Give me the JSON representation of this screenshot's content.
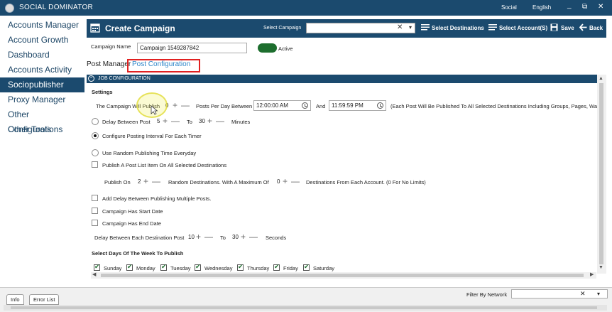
{
  "titlebar": {
    "app_title": "SOCIAL DOMINATOR",
    "menu_social": "Social",
    "menu_language": "English",
    "minimize": "_",
    "restore": "⧉",
    "close": "✕"
  },
  "sidebar": {
    "items": [
      {
        "label": "Accounts Manager"
      },
      {
        "label": "Account Growth"
      },
      {
        "label": "Dashboard"
      },
      {
        "label": "Accounts Activity"
      },
      {
        "label": "Sociopublisher"
      },
      {
        "label": "Proxy Manager"
      },
      {
        "label": "Other Configurations"
      },
      {
        "label": "Other Tools"
      }
    ],
    "active_index": 4
  },
  "header": {
    "title": "Create Campaign",
    "select_campaign_label": "Select Campaign",
    "select_campaign_value": "",
    "clear_glyph": "✕",
    "dropdown_glyph": "▾",
    "select_destinations": "Select Destinations",
    "select_accounts": "Select Account(S)",
    "save": "Save",
    "back": "Back"
  },
  "campaign": {
    "name_label": "Campaign Name",
    "name_value": "Campaign 1549287842",
    "active_label": "Active",
    "active": true
  },
  "tabs": {
    "post_manager": "Post Manager",
    "post_configuration": "Post Configuration"
  },
  "section": {
    "title": "JOB CONFIGURATION",
    "collapse_glyph": "⌃"
  },
  "settings": {
    "heading": "Settings",
    "campaign_will_publish_label": "The Campaign Will Publish",
    "campaign_will_publish_value": "0",
    "posts_per_day_between": "Posts Per Day Between",
    "start_time": "12:00:00 AM",
    "and_label": "And",
    "end_time": "11:59:59 PM",
    "destinations_note": "(Each Post Will Be Published To All Selected Destinations Including Groups, Pages, Walls)",
    "delay_between_post_label": "Delay Between Post",
    "delay_from": "5",
    "to_label": "To",
    "delay_to": "30",
    "minutes_label": "Minutes",
    "configure_interval_label": "Configure Posting Interval For Each Timer",
    "random_time_label": "Use Random Publishing Time Everyday",
    "publish_all_label": "Publish A Post List Item On All Selected Destinations",
    "publish_on_label": "Publish On",
    "publish_on_value": "2",
    "random_dest_label": "Random Destinations. With A Maximum Of",
    "max_value": "0",
    "dest_from_account_label": "Destinations From Each Account. (0 For No Limits)",
    "add_delay_label": "Add Delay Between Publishing Multiple Posts.",
    "start_date_label": "Campaign Has Start Date",
    "end_date_label": "Campaign Has End Date",
    "dest_delay_label": "Delay Between Each Destination Post",
    "dest_delay_from": "10",
    "dest_delay_to": "30",
    "seconds_label": "Seconds",
    "days_heading": "Select Days Of The Week To Publish",
    "days": [
      "Sunday",
      "Monday",
      "Tuesday",
      "Wednesday",
      "Thursday",
      "Friday",
      "Saturday"
    ],
    "plus_glyph": "+",
    "minus_glyph": "—"
  },
  "bottom": {
    "tab_info": "Info",
    "tab_error": "Error List",
    "filter_label": "Filter By Network",
    "filter_clear": "✕",
    "filter_dropdown": "▾"
  },
  "colors": {
    "primary": "#1b4a6e",
    "toggle_on": "#1d6e2e",
    "highlight": "#e12020"
  }
}
